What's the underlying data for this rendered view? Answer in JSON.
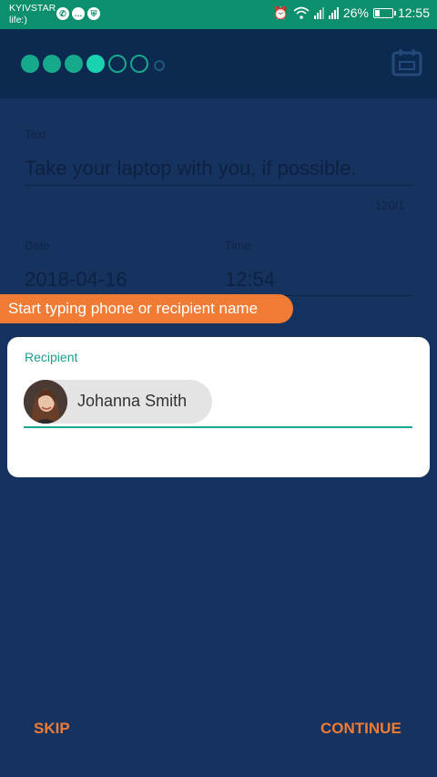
{
  "status_bar": {
    "carrier_line1": "KYIVSTAR",
    "carrier_line2": "life:)",
    "battery_text": "26%",
    "time": "12:55",
    "icons": [
      "viber-icon",
      "chat-bubble-icon",
      "shield-icon",
      "alarm-icon",
      "wifi-icon",
      "signal-icon",
      "signal-icon",
      "battery-charging-icon"
    ],
    "battery_level": 0.26
  },
  "progress": {
    "steps_total": 7,
    "steps_completed": 3,
    "current_step": 4
  },
  "form": {
    "text_label": "Text",
    "text_value": "Take your laptop with you, if possible.",
    "char_counter": "120/1",
    "date_label": "Date",
    "date_value": "2018-04-16",
    "time_label": "Time",
    "time_value": "12:54"
  },
  "tooltip": {
    "text": "Start typing phone or recipient name"
  },
  "recipient_card": {
    "label": "Recipient",
    "chip_name": "Johanna Smith"
  },
  "buttons": {
    "skip": "SKIP",
    "continue": "CONTINUE"
  },
  "colors": {
    "status_bar": "#0b8f6c",
    "header": "#0c2950",
    "background": "#16325f",
    "accent_orange": "#f07b35",
    "accent_teal": "#1ba891"
  }
}
